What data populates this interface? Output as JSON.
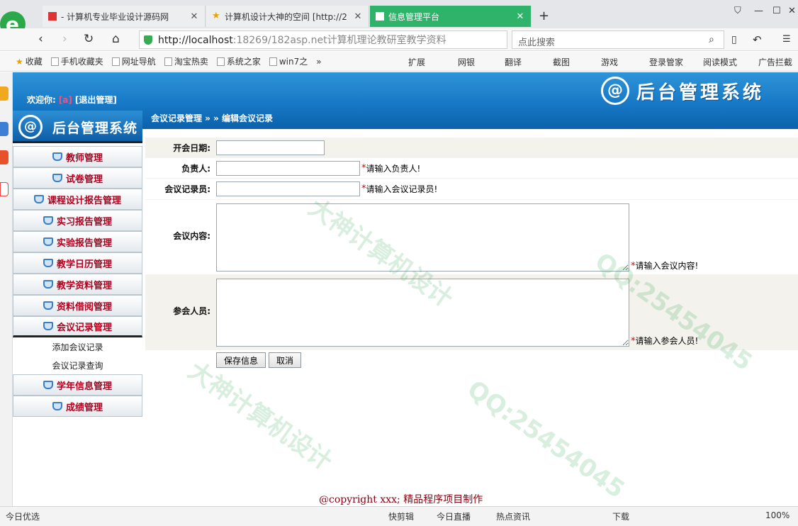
{
  "browser": {
    "tabs": [
      {
        "title": "- 计算机专业毕业设计源码网",
        "active": false
      },
      {
        "title": "计算机设计大神的空间 [http://2",
        "active": false
      },
      {
        "title": "信息管理平台",
        "active": true
      }
    ],
    "new_tab": "+",
    "url_host": "http://localhost",
    "url_rest": ":18269/182asp.net计算机理论教研室教学资料",
    "search_placeholder": "点此搜索",
    "bookmarks": [
      "收藏",
      "手机收藏夹",
      "网址导航",
      "淘宝热卖",
      "系统之家",
      "win7之"
    ],
    "bookmarks_more": "»",
    "right_tools": [
      "扩展",
      "网银",
      "翻译",
      "截图",
      "游戏",
      "登录管家",
      "阅读模式",
      "广告拦截"
    ]
  },
  "header": {
    "welcome_label": "欢迎你:",
    "username": "[a]",
    "logout": "[退出管理]",
    "system_title": "后台管理系统",
    "breadcrumb": "会议记录管理 » » 编辑会议记录"
  },
  "sidebar": {
    "logo_text": "后台管理系统",
    "menus": [
      {
        "label": "教师管理"
      },
      {
        "label": "试卷管理"
      },
      {
        "label": "课程设计报告管理"
      },
      {
        "label": "实习报告管理"
      },
      {
        "label": "实验报告管理"
      },
      {
        "label": "教学日历管理"
      },
      {
        "label": "教学资料管理"
      },
      {
        "label": "资料借阅管理"
      },
      {
        "label": "会议记录管理"
      }
    ],
    "submenu": [
      "添加会议记录",
      "会议记录查询"
    ],
    "menus_after": [
      {
        "label": "学年信息管理"
      },
      {
        "label": "成绩管理"
      }
    ]
  },
  "form": {
    "date_label": "开会日期:",
    "owner_label": "负责人:",
    "owner_hint": "请输入负责人!",
    "recorder_label": "会议记录员:",
    "recorder_hint": "请输入会议记录员!",
    "content_label": "会议内容:",
    "content_hint": "请输入会议内容!",
    "attendees_label": "参会人员:",
    "attendees_hint": "请输入参会人员!",
    "required_mark": "*",
    "save_label": "保存信息",
    "cancel_label": "取消"
  },
  "footer": {
    "copyright": "@copyright xxx; 精品程序项目制作"
  },
  "statusbar": {
    "left": "今日优选",
    "items": [
      "快剪辑",
      "今日直播",
      "热点资讯",
      "下载"
    ],
    "zoom": "100%"
  },
  "watermark": {
    "lines": [
      "大神计算机设计",
      "QQ:25454045"
    ]
  },
  "colors": {
    "header_blue": "#1779c6",
    "menu_text": "#b3001e",
    "active_tab": "#2fb36a"
  }
}
